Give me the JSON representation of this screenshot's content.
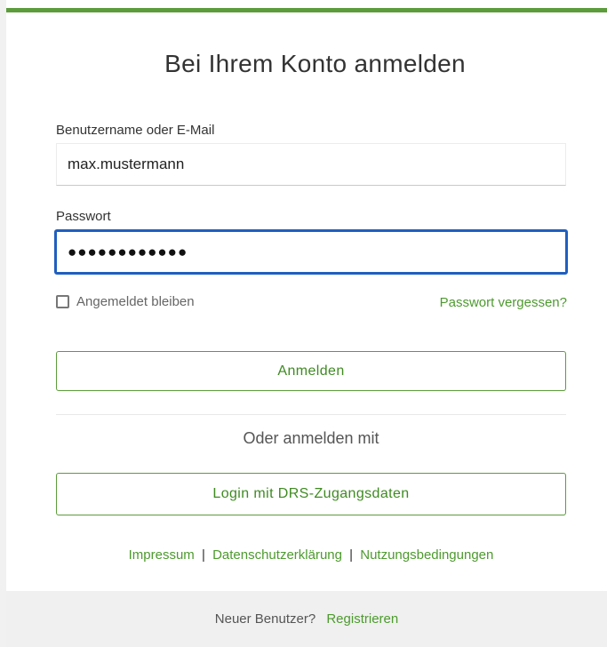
{
  "page": {
    "title": "Bei Ihrem Konto anmelden"
  },
  "form": {
    "username_label": "Benutzername oder E-Mail",
    "username_value": "max.mustermann",
    "password_label": "Passwort",
    "password_mask": "●●●●●●●●●●●●",
    "remember_label": "Angemeldet bleiben",
    "remember_checked": false,
    "forgot_label": "Passwort vergessen?",
    "submit_label": "Anmelden"
  },
  "alt_login": {
    "or_text": "Oder anmelden mit",
    "drs_label": "Login mit DRS-Zugangsdaten"
  },
  "links": {
    "impressum": "Impressum",
    "privacy": "Datenschutzerklärung",
    "terms": "Nutzungsbedingungen",
    "separator": "|"
  },
  "footer": {
    "question": "Neuer Benutzer?",
    "register_label": "Registrieren"
  },
  "colors": {
    "accent_green": "#5c9c3c",
    "link_green": "#4d9a2e",
    "focus_blue": "#1f5fbf"
  }
}
